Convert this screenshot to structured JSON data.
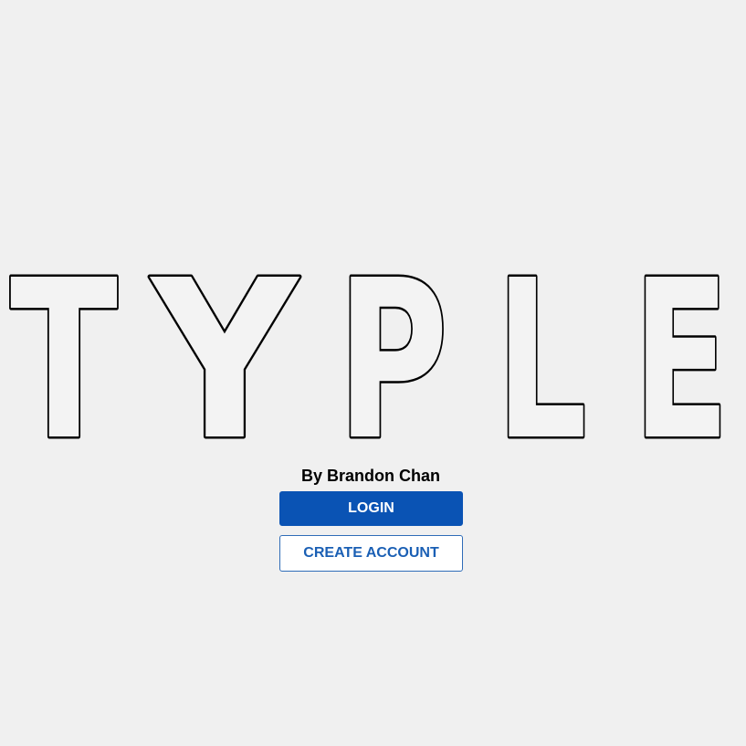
{
  "logo": {
    "letters": [
      "T",
      "Y",
      "P",
      "L",
      "E"
    ]
  },
  "byline": "By Brandon Chan",
  "buttons": {
    "login_label": "LOGIN",
    "create_account_label": "CREATE ACCOUNT"
  },
  "colors": {
    "background": "#f0f0f0",
    "primary": "#0a53b4",
    "primary_text": "#ffffff",
    "secondary_text": "#1a5fb4",
    "logo_outline": "#000000"
  }
}
